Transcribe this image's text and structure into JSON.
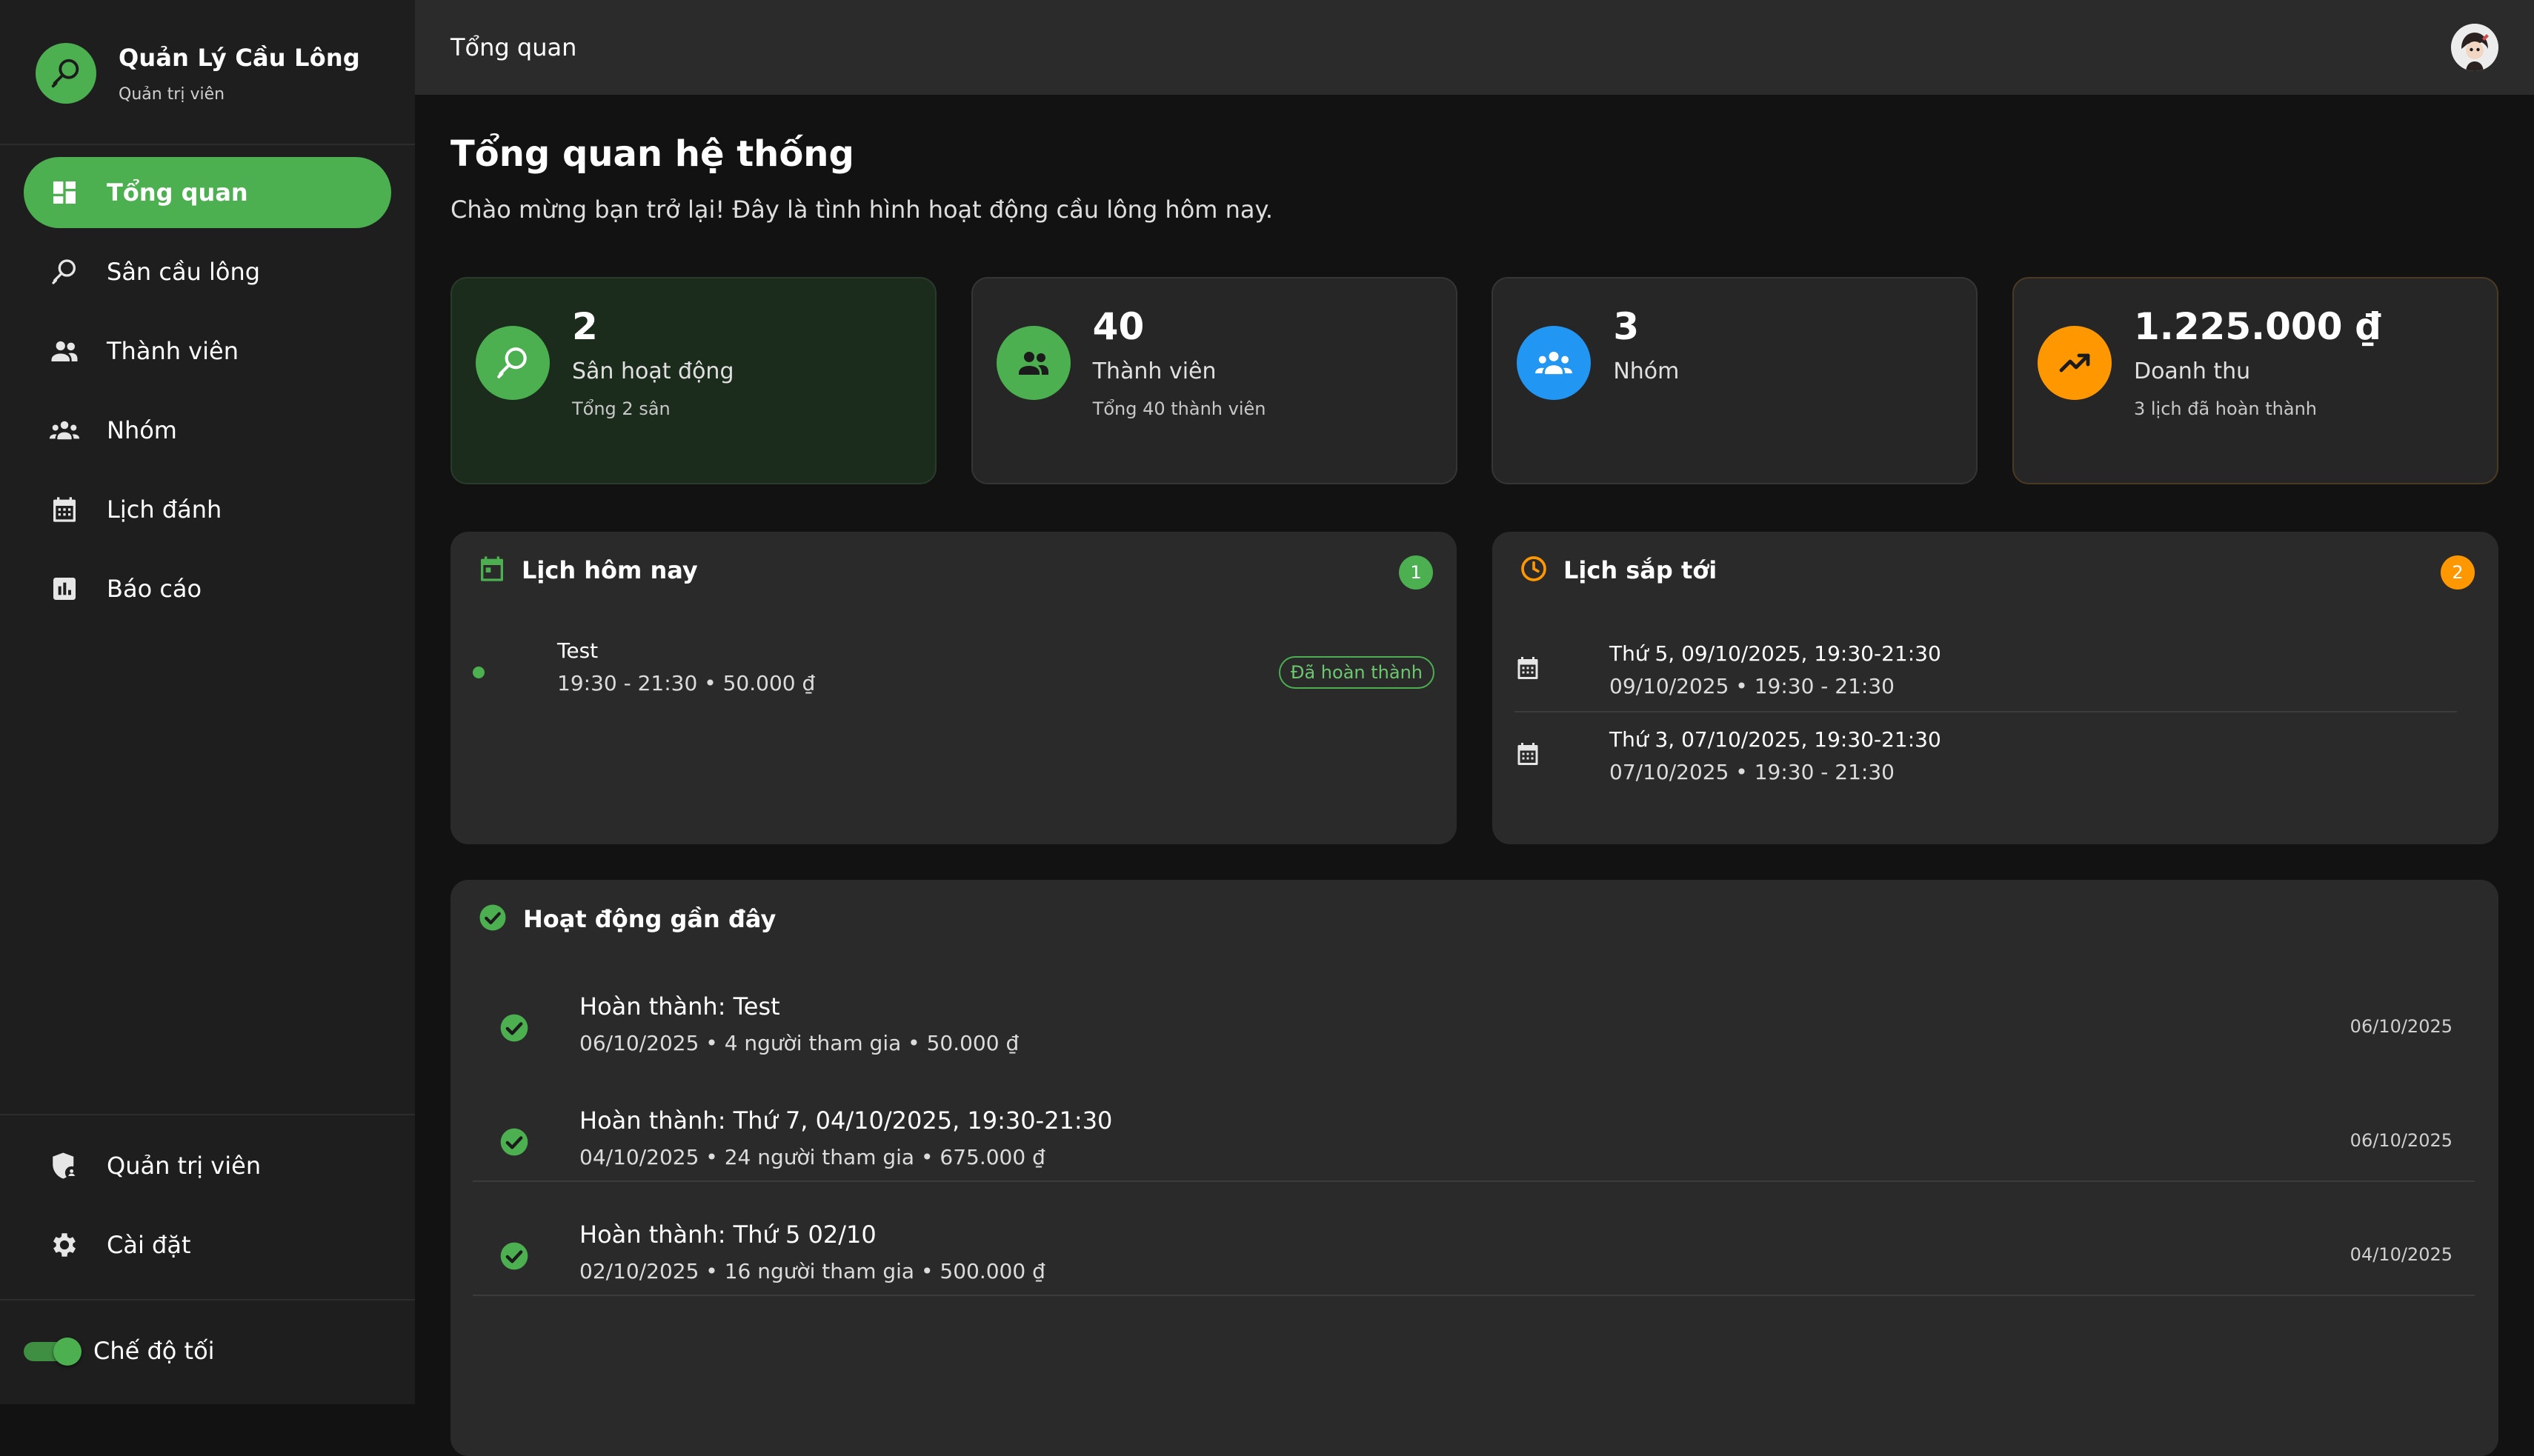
{
  "brand": {
    "title": "Quản Lý Cầu Lông",
    "subtitle": "Quản trị viên"
  },
  "nav": {
    "items": [
      {
        "label": "Tổng quan",
        "icon": "dashboard-icon",
        "active": true
      },
      {
        "label": "Sân cầu lông",
        "icon": "badminton-racket-icon"
      },
      {
        "label": "Thành viên",
        "icon": "people-icon"
      },
      {
        "label": "Nhóm",
        "icon": "groups-icon"
      },
      {
        "label": "Lịch đánh",
        "icon": "calendar-icon"
      },
      {
        "label": "Báo cáo",
        "icon": "report-chart-icon"
      }
    ],
    "bottom": [
      {
        "label": "Quản trị viên",
        "icon": "admin-shield-icon"
      },
      {
        "label": "Cài đặt",
        "icon": "gear-icon"
      }
    ]
  },
  "dark_mode": {
    "label": "Chế độ tối",
    "on": true
  },
  "topbar": {
    "title": "Tổng quan"
  },
  "page": {
    "title": "Tổng quan hệ thống",
    "subtitle": "Chào mừng bạn trở lại! Đây là tình hình hoạt động cầu lông hôm nay."
  },
  "stats": [
    {
      "value": "2",
      "label": "Sân hoạt động",
      "sub": "Tổng 2 sân",
      "icon": "badminton-racket-icon",
      "color": "#4caf50"
    },
    {
      "value": "40",
      "label": "Thành viên",
      "sub": "Tổng 40 thành viên",
      "icon": "people-icon",
      "color": "#4caf50"
    },
    {
      "value": "3",
      "label": "Nhóm",
      "sub": "",
      "icon": "groups-icon",
      "color": "#2196f3"
    },
    {
      "value": "1.225.000 ₫",
      "label": "Doanh thu",
      "sub": "3 lịch đã hoàn thành",
      "icon": "trending-up-icon",
      "color": "#ff9800"
    }
  ],
  "today": {
    "title": "Lịch hôm nay",
    "count": "1",
    "items": [
      {
        "title": "Test",
        "sub": "19:30 - 21:30 • 50.000 ₫",
        "badge": "Đã hoàn thành"
      }
    ]
  },
  "upcoming": {
    "title": "Lịch sắp tới",
    "count": "2",
    "items": [
      {
        "title": "Thứ 5, 09/10/2025, 19:30-21:30",
        "sub": "09/10/2025 • 19:30 - 21:30"
      },
      {
        "title": "Thứ 3, 07/10/2025, 19:30-21:30",
        "sub": "07/10/2025 • 19:30 - 21:30"
      }
    ]
  },
  "recent": {
    "title": "Hoạt động gần đây",
    "items": [
      {
        "title": "Hoàn thành: Test",
        "sub": "06/10/2025 • 4 người tham gia • 50.000 ₫",
        "date": "06/10/2025"
      },
      {
        "title": "Hoàn thành: Thứ 7, 04/10/2025, 19:30-21:30",
        "sub": "04/10/2025 • 24 người tham gia • 675.000 ₫",
        "date": "06/10/2025"
      },
      {
        "title": "Hoàn thành: Thứ 5 02/10",
        "sub": "02/10/2025 • 16 người tham gia • 500.000 ₫",
        "date": "04/10/2025"
      }
    ]
  },
  "colors": {
    "accent": "#4caf50",
    "blue": "#2196f3",
    "orange": "#ff9800"
  }
}
